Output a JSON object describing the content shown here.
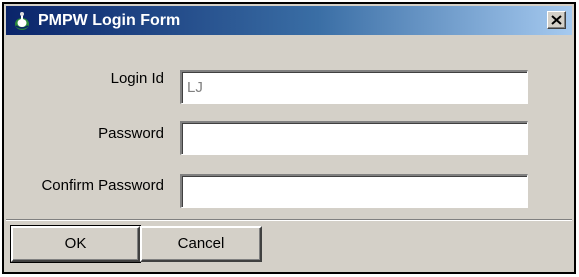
{
  "window": {
    "title": "PMPW Login Form",
    "close_symbol": "×"
  },
  "form": {
    "login_id": {
      "label": "Login Id",
      "value": "LJ"
    },
    "password": {
      "label": "Password",
      "value": ""
    },
    "confirm_password": {
      "label": "Confirm Password",
      "value": ""
    }
  },
  "buttons": {
    "ok_label": "OK",
    "cancel_label": "Cancel"
  },
  "icons": {
    "app": "app-icon",
    "close": "close-icon"
  },
  "colors": {
    "titlebar_start": "#0a246a",
    "titlebar_end": "#a6caf0",
    "face": "#d4d0c8"
  }
}
